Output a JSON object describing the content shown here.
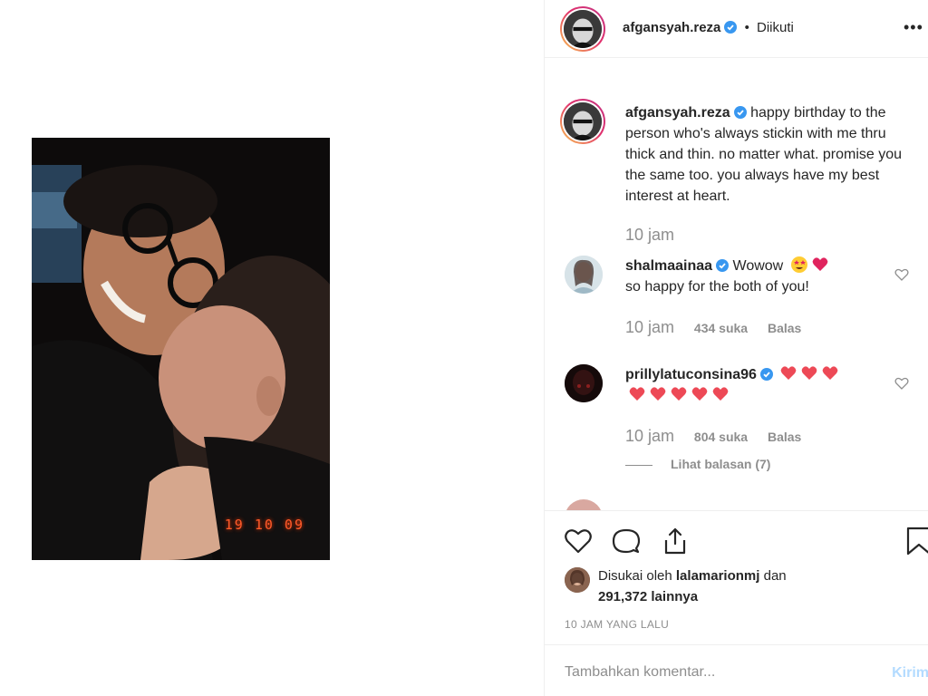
{
  "post": {
    "photo_date_stamp": "19 10 09"
  },
  "header": {
    "username": "afgansyah.reza",
    "separator": "•",
    "follow_status": "Diikuti",
    "more_icon": "more-horizontal-icon",
    "more_label": "•••"
  },
  "caption": {
    "username": "afgansyah.reza",
    "text": "happy birthday to the person who's always stickin with me thru thick and thin. no matter what. promise you the same too. you always have my best interest at heart.",
    "time": "10 jam"
  },
  "comments": [
    {
      "username": "shalmaainaa",
      "text_line1": "Wowow",
      "text_line2": "so happy for the both of you!",
      "emojis": [
        "star-struck-emoji",
        "heart-emoji"
      ],
      "time": "10 jam",
      "likes": "434 suka",
      "reply": "Balas"
    },
    {
      "username": "prillylatuconsina96",
      "hearts_line1": 3,
      "hearts_line2": 5,
      "time": "10 jam",
      "likes": "804 suka",
      "reply": "Balas",
      "view_replies": "Lihat balasan (7)"
    }
  ],
  "actions": {
    "icons": [
      "heart-icon",
      "comment-icon",
      "share-icon",
      "bookmark-icon"
    ],
    "liked_by_prefix": "Disukai oleh",
    "liked_by_user": "lalamarionmj",
    "liked_by_and": "dan",
    "liked_by_count": "291,372 lainnya",
    "timestamp": "10 JAM YANG LALU"
  },
  "add_comment": {
    "placeholder": "Tambahkan komentar...",
    "post_label": "Kirim"
  },
  "colors": {
    "verified_blue": "#3897f0",
    "text_primary": "#262626",
    "text_secondary": "#8e8e8e",
    "post_disabled": "#b3dbff",
    "heart_red": "#ed4956"
  }
}
